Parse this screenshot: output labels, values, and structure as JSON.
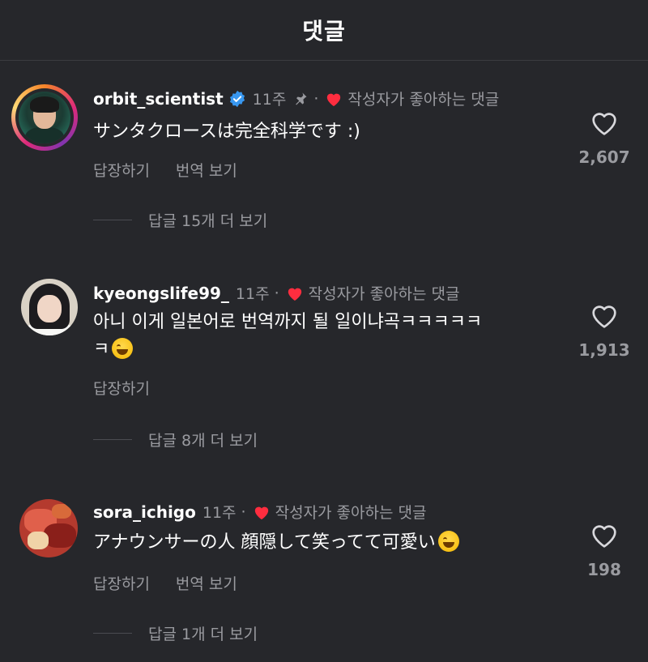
{
  "header": {
    "title": "댓글"
  },
  "comments": [
    {
      "username": "orbit_scientist",
      "time": "11주",
      "dot": "·",
      "liked_label": "작성자가 좋아하는 댓글",
      "text": "サンタクロースは完全科学です :)",
      "reply_label": "답장하기",
      "translate_label": "번역 보기",
      "like_count": "2,607",
      "more_replies": "답글 15개 더 보기"
    },
    {
      "username": "kyeongslife99_",
      "time": "11주",
      "dot": "·",
      "liked_label": "작성자가 좋아하는 댓글",
      "text_line1": "아니 이게 일본어로 번역까지 될 일이냐곡ㅋㅋㅋㅋㅋ",
      "text_line2": "ㅋ",
      "reply_label": "답장하기",
      "like_count": "1,913",
      "more_replies": "답글 8개 더 보기"
    },
    {
      "username": "sora_ichigo",
      "time": "11주",
      "dot": "·",
      "liked_label": "작성자가 좋아하는 댓글",
      "text": "アナウンサーの人 顔隠して笑ってて可愛い",
      "reply_label": "답장하기",
      "translate_label": "번역 보기",
      "like_count": "198",
      "more_replies": "답글 1개 더 보기"
    }
  ]
}
